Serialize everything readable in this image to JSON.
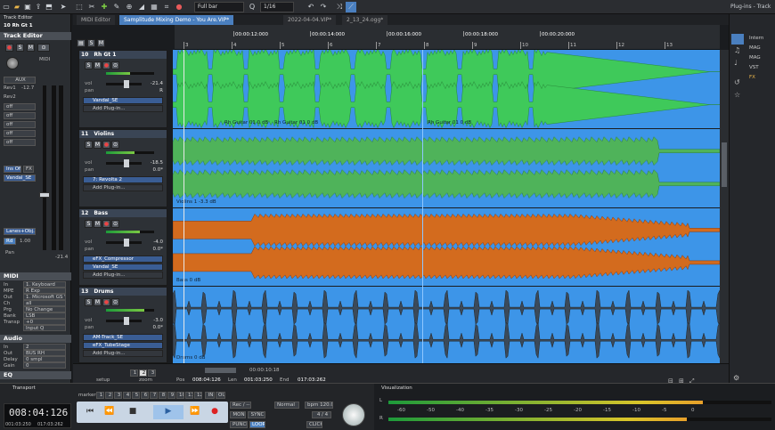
{
  "toolbar": {
    "snap_select": "Full bar",
    "quant_select": "1/16"
  },
  "track_editor": {
    "title": "Track Editor",
    "panel_label": "Track Editor",
    "track_name": "10 Rh Gt 1",
    "midi_label": "MIDI",
    "aux_label": "AUX",
    "rev_values": [
      "Rev1",
      "Rev2"
    ],
    "rev_level": "-12.7",
    "off_labels": [
      "off",
      "off",
      "off",
      "off",
      "off"
    ],
    "ins_off": "Ins Off",
    "fx": "FX",
    "vandal": "Vandal_SE",
    "lanes_auto": "Lanes+Obj.Auto",
    "rd": "Rd",
    "rd_val": "1.00",
    "pan": "Pan",
    "vol_db": "-21.4",
    "midi_section": "MIDI",
    "midi_rows": [
      {
        "label": "In",
        "value": "1. Keyboard"
      },
      {
        "label": "MPE",
        "value": "R Exp"
      },
      {
        "label": "Out",
        "value": "1. Microsoft GS W"
      },
      {
        "label": "Ch",
        "value": "all"
      },
      {
        "label": "Prg",
        "value": "No Change"
      },
      {
        "label": "Bank",
        "value": "LSB"
      },
      {
        "label": "Transp",
        "value": "+0"
      },
      {
        "label": "",
        "value": "Input Q"
      }
    ],
    "audio_section": "Audio",
    "audio_rows": [
      {
        "label": "In",
        "value": "2"
      },
      {
        "label": "Out",
        "value": "BUS RH"
      },
      {
        "label": "Delay",
        "value": "0 smpl"
      },
      {
        "label": "Gain",
        "value": "0"
      }
    ],
    "eq_section": "EQ"
  },
  "tabs": [
    "MIDI Editor",
    "Samplitude Mixing Demo - You Are.VIP*",
    "2022-04-04.VIP*",
    "2_13_24.ogg*"
  ],
  "ruler": {
    "times": [
      "00:00:12:000",
      "00:00:14:000",
      "00:00:16:000",
      "00:00:18:000",
      "00:00:20:000"
    ],
    "bars": [
      "3",
      "4",
      "5",
      "6",
      "7",
      "8",
      "9",
      "10",
      "11",
      "12",
      "13"
    ]
  },
  "tracks": [
    {
      "num": "10",
      "name": "Rh Gt 1",
      "vol": "-21.4",
      "pan": "R",
      "plugins": [
        "Vandal_SE"
      ],
      "add": "Add Plug-in...",
      "clips": [
        "Rh Guitar 01 0 dB",
        "Rh Guitar 01 0 dB",
        "Rh Guitar 01 0 dB"
      ]
    },
    {
      "num": "11",
      "name": "Violins",
      "vol": "-18.5",
      "pan": "0.0*",
      "plugins": [
        "7: Revolta 2"
      ],
      "add": "Add Plug-in...",
      "clips": [
        "Violins 1 -3.3 dB"
      ]
    },
    {
      "num": "12",
      "name": "Bass",
      "vol": "-4.0",
      "pan": "0.0*",
      "plugins": [
        "eFX_Compressor",
        "Vandal_SE"
      ],
      "add": "Add Plug-in...",
      "clips": [
        "Bass 0 dB"
      ]
    },
    {
      "num": "13",
      "name": "Drums",
      "vol": "-3.0",
      "pan": "0.0*",
      "plugins": [
        "AM-Track_SE",
        "eFX_TubeStage"
      ],
      "add": "Add Plug-in...",
      "clips": [
        "Drums 0 dB"
      ]
    }
  ],
  "bottom_bar": {
    "setup": "setup",
    "zoom": "zoom",
    "pos_label": "Pos",
    "pos": "008:04:126",
    "len_label": "Len",
    "len": "001:03:250",
    "end_label": "End",
    "end": "017:03:262",
    "scroll_time": "00:00:10:18",
    "zoom_nums": [
      "1",
      "2",
      "3"
    ]
  },
  "plugin_panel": {
    "title": "Plug-ins - Track",
    "items": [
      "Intern",
      "MAG",
      "MAG",
      "VST",
      "FX"
    ]
  },
  "transport": {
    "title": "Transport",
    "marker": "marker",
    "marker_nums": [
      "1",
      "2",
      "3",
      "4",
      "5",
      "6",
      "7",
      "8",
      "9",
      "10",
      "11",
      "12"
    ],
    "in_out": [
      "IN",
      "OUT"
    ],
    "time": "008:04:126",
    "sub1": "001:03:250",
    "sub2": "017:03:262",
    "rec_mode": "Rec / --",
    "normal": "Normal",
    "bpm": "bpm 120.0",
    "sig": "4 / 4",
    "mon": "MON",
    "sync": "SYNC",
    "punch": "PUNCH",
    "loop": "LOOP",
    "click": "CLICK"
  },
  "visualization": {
    "title": "Visualization",
    "scale": [
      "-60",
      "-50",
      "-40",
      "-35",
      "-30",
      "-25",
      "-20",
      "-15",
      "-10",
      "-5",
      "0"
    ],
    "channels": [
      "L",
      "R"
    ]
  },
  "colors": {
    "accent": "#4a7fbf",
    "lane": "#3d95e8",
    "green_wave": "#3fc95a",
    "orange_wave": "#d36b1e"
  }
}
